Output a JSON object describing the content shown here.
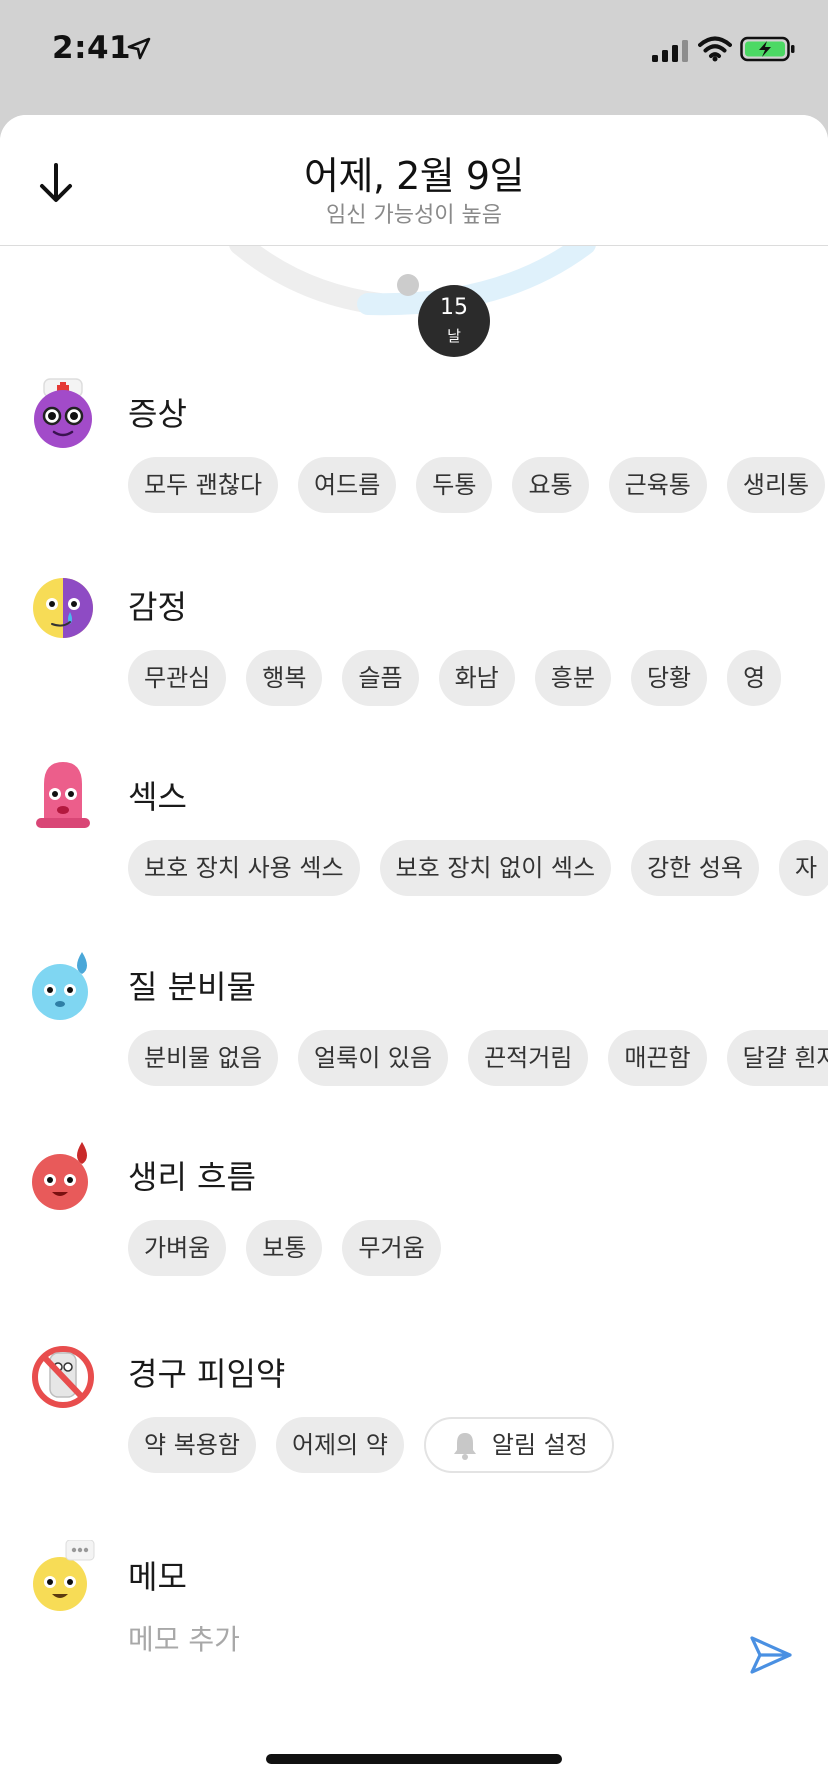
{
  "status_bar": {
    "time": "2:41"
  },
  "header": {
    "title": "어제, 2월 9일",
    "subtitle": "임신 가능성이 높음"
  },
  "cycle": {
    "day_number": "15",
    "day_unit": "날"
  },
  "sections": [
    {
      "title": "증상",
      "chips": [
        "모두 괜찮다",
        "여드름",
        "두통",
        "요통",
        "근육통",
        "생리통"
      ]
    },
    {
      "title": "감정",
      "chips": [
        "무관심",
        "행복",
        "슬픔",
        "화남",
        "흥분",
        "당황",
        "영"
      ]
    },
    {
      "title": "섹스",
      "chips": [
        "보호 장치 사용 섹스",
        "보호 장치 없이 섹스",
        "강한 성욕",
        "자"
      ]
    },
    {
      "title": "질 분비물",
      "chips": [
        "분비물 없음",
        "얼룩이 있음",
        "끈적거림",
        "매끈함",
        "달걀 흰자"
      ]
    },
    {
      "title": "생리 흐름",
      "chips": [
        "가벼움",
        "보통",
        "무거움"
      ]
    },
    {
      "title": "경구 피임약",
      "chips": [
        "약 복용함",
        "어제의 약"
      ],
      "reminder_label": "알림 설정"
    },
    {
      "title": "메모",
      "placeholder": "메모 추가"
    }
  ],
  "colors": {
    "accent": "#4a90e2",
    "chip_bg": "#ebebeb",
    "cycle_blue": "#dff1fb",
    "cycle_gray": "#eeeeee"
  },
  "icons": [
    "location-arrow-icon",
    "signal-icon",
    "wifi-icon",
    "battery-icon",
    "arrow-down-icon",
    "nurse-emoji-icon",
    "mood-emoji-icon",
    "condom-emoji-icon",
    "droplet-emoji-icon",
    "blood-drop-emoji-icon",
    "no-pill-emoji-icon",
    "memo-emoji-icon",
    "bell-icon",
    "send-icon"
  ]
}
